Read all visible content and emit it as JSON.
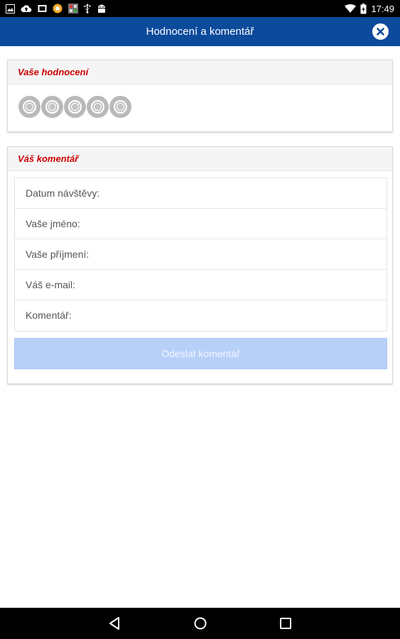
{
  "status_bar": {
    "time": "17:49",
    "left_icons": [
      "image-icon",
      "cloud-upload-icon",
      "screen-icon",
      "notification-circle-icon",
      "app-icon",
      "usb-icon",
      "android-icon"
    ],
    "right_icons": [
      "wifi-icon",
      "battery-charging-icon"
    ]
  },
  "app_bar": {
    "title": "Hodnocení a komentář",
    "close_icon": "close-icon"
  },
  "rating_section": {
    "title": "Vaše hodnocení",
    "star_count": 5,
    "selected": 0,
    "star_color": "#b9b9b9"
  },
  "comment_section": {
    "title": "Váš komentář",
    "fields": [
      {
        "label": "Datum návštěvy:"
      },
      {
        "label": "Vaše jméno:"
      },
      {
        "label": "Vaše příjmení:"
      },
      {
        "label": "Váš e-mail:"
      },
      {
        "label": "Komentář:"
      }
    ],
    "submit_label": "Odeslat komentář"
  },
  "nav_bar": {
    "icons": [
      "back-icon",
      "home-icon",
      "recents-icon"
    ]
  },
  "colors": {
    "accent": "#0c4a9c",
    "section_title": "#cc0000",
    "button_disabled": "#b7d0f8"
  }
}
